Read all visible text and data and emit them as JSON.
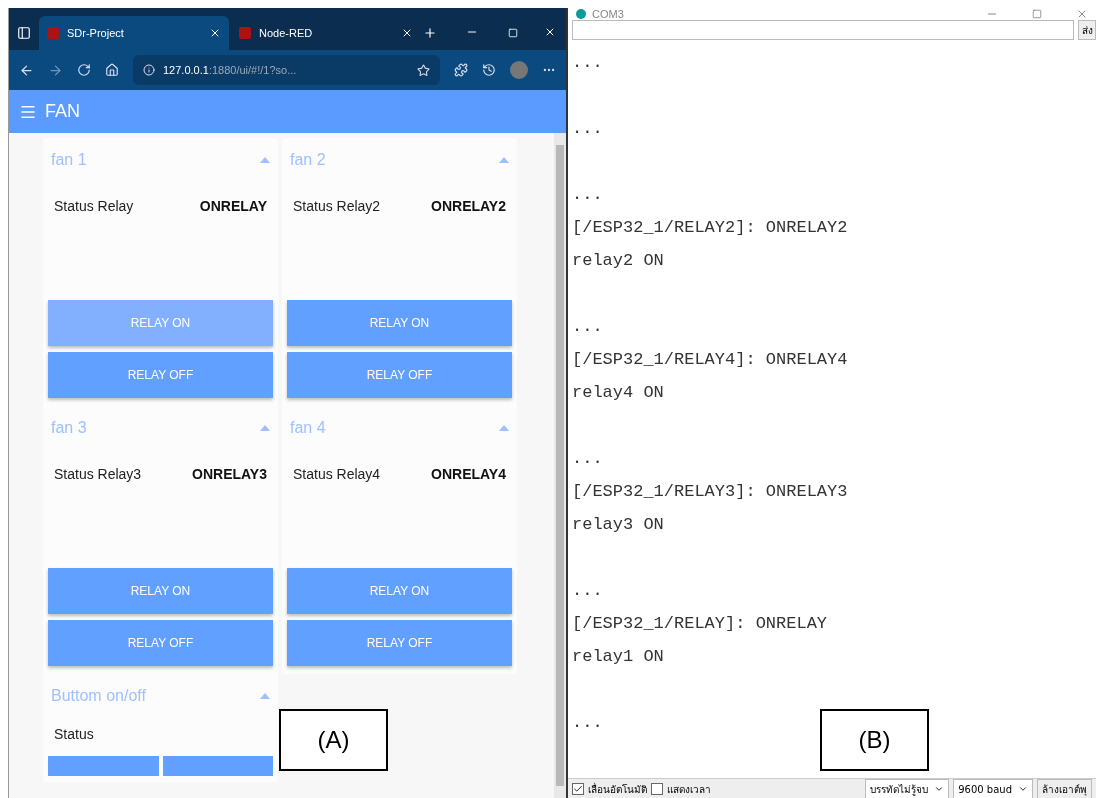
{
  "browser": {
    "tabs": [
      {
        "title": "SDr-Project",
        "selected": true
      },
      {
        "title": "Node-RED",
        "selected": false
      }
    ],
    "address": {
      "host": "127.0.0.1",
      "rest": ":1880/ui/#!/1?so..."
    },
    "dashboard": {
      "title": "FAN",
      "groups": [
        {
          "title": "fan 1",
          "label": "Status Relay",
          "value": "ONRELAY",
          "buttons": [
            {
              "label": "RELAY ON",
              "highlighted": true
            },
            {
              "label": "RELAY OFF",
              "highlighted": false
            }
          ]
        },
        {
          "title": "fan 2",
          "label": "Status Relay2",
          "value": "ONRELAY2",
          "buttons": [
            {
              "label": "RELAY ON",
              "highlighted": false
            },
            {
              "label": "RELAY OFF",
              "highlighted": false
            }
          ]
        },
        {
          "title": "fan 3",
          "label": "Status Relay3",
          "value": "ONRELAY3",
          "buttons": [
            {
              "label": "RELAY ON",
              "highlighted": false
            },
            {
              "label": "RELAY OFF",
              "highlighted": false
            }
          ]
        },
        {
          "title": "fan 4",
          "label": "Status Relay4",
          "value": "ONRELAY4",
          "buttons": [
            {
              "label": "RELAY ON",
              "highlighted": false
            },
            {
              "label": "RELAY OFF",
              "highlighted": false
            }
          ]
        }
      ],
      "bottom_group": {
        "title": "Buttom on/off",
        "label": "Status"
      }
    }
  },
  "serial_monitor": {
    "title": "COM3",
    "send_button": "ส่ง",
    "blocks": [
      [
        "..."
      ],
      [
        "..."
      ],
      [
        "...",
        "[/ESP32_1/RELAY2]: ONRELAY2",
        "relay2 ON"
      ],
      [
        "...",
        "[/ESP32_1/RELAY4]: ONRELAY4",
        "relay4 ON"
      ],
      [
        "...",
        "[/ESP32_1/RELAY3]: ONRELAY3",
        "relay3 ON"
      ],
      [
        "...",
        "[/ESP32_1/RELAY]: ONRELAY",
        "relay1 ON"
      ],
      [
        "..."
      ]
    ],
    "autoscroll": {
      "label": "เลื่อนอัตโนมัติ",
      "checked": true
    },
    "timestamp": {
      "label": "แสดงเวลา",
      "checked": false
    },
    "line_ending": "บรรทัดไม่รู้จบ",
    "baud": "9600 baud",
    "clear_button": "ล้างเอาต์พุ"
  },
  "annotations": [
    "(A)",
    "(B)"
  ]
}
